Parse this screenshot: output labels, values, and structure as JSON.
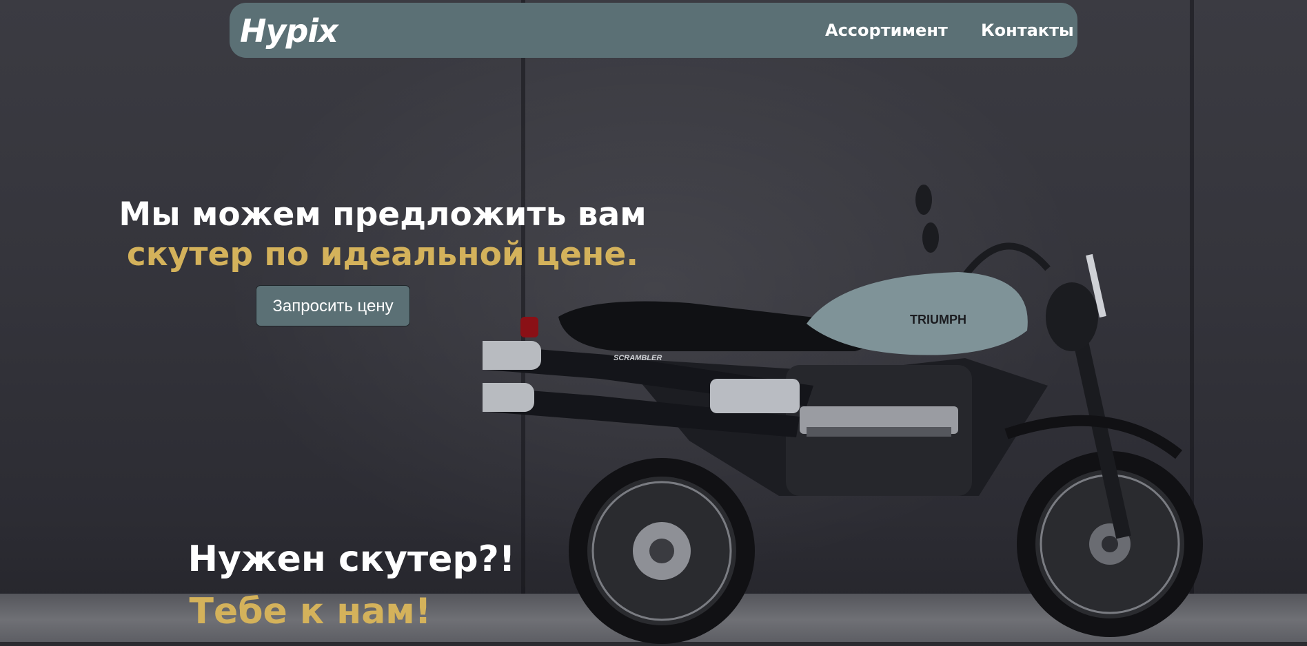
{
  "navbar": {
    "logo": "Hypix",
    "links": [
      {
        "label": "Ассортимент"
      },
      {
        "label": "Контакты"
      }
    ]
  },
  "hero": {
    "headline_line1": "Мы можем предложить вам",
    "headline_line2": "скутер по идеальной цене.",
    "cta_label": "Запросить цену",
    "bottom_line1": "Нужен скутер?!",
    "bottom_line2": "Тебе к нам!",
    "bike_brand": "TRIUMPH",
    "bike_model": "SCRAMBLER"
  },
  "colors": {
    "navbar_bg": "#5b7075",
    "accent_gold": "#d4b25b",
    "text_white": "#ffffff",
    "tank_color": "#7f9398"
  }
}
